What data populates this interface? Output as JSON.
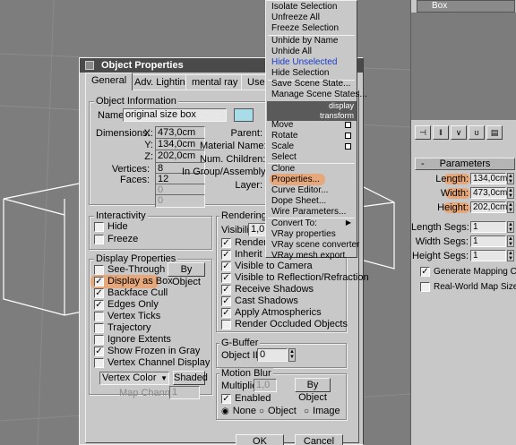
{
  "colors": {
    "accent_blue": "#1a3cc8",
    "highlight": "#ff8c3c",
    "swatch": "#a8dce8",
    "title_bg": "#4a4a4a"
  },
  "dialog": {
    "title": "Object Properties",
    "tabs": [
      "General",
      "Adv. Lighting",
      "mental ray",
      "User D"
    ],
    "object_info": {
      "group_title": "Object Information",
      "name_label": "Name:",
      "name_value": "original size box",
      "dimensions_label": "Dimensions:",
      "x_label": "X:",
      "x_value": "473,0cm",
      "y_label": "Y:",
      "y_value": "134,0cm",
      "z_label": "Z:",
      "z_value": "202,0cm",
      "vertices_label": "Vertices:",
      "vertices_value": "8",
      "faces_label": "Faces:",
      "faces_value": "12",
      "blank1": "0",
      "blank2": "0",
      "parent_label": "Parent:",
      "material_label": "Material Name:",
      "children_label": "Num. Children:",
      "group_label": "In Group/Assembly:",
      "layer_label": "Layer:"
    },
    "interactivity": {
      "title": "Interactivity",
      "hide": "Hide",
      "freeze": "Freeze"
    },
    "display_props": {
      "title": "Display Properties",
      "see_through": "See-Through",
      "by_object": "By Object",
      "display_as_box": "Display as Box",
      "backface_cull": "Backface Cull",
      "edges_only": "Edges Only",
      "vertex_ticks": "Vertex Ticks",
      "trajectory": "Trajectory",
      "ignore_extents": "Ignore Extents",
      "show_frozen_gray": "Show Frozen in Gray",
      "vertex_channel_display": "Vertex Channel Display",
      "vertex_color": "Vertex Color",
      "shaded": "Shaded",
      "map_channel_label": "Map Channel:",
      "map_channel_value": "1"
    },
    "rendering": {
      "title": "Rendering Co",
      "visibility_label": "Visibility:",
      "visibility_value": "1,0",
      "renderable": "Renderab",
      "inherit_visibility": "Inherit Visi",
      "visible_camera": "Visible to Camera",
      "visible_reflection": "Visible to Reflection/Refraction",
      "receive_shadows": "Receive Shadows",
      "cast_shadows": "Cast Shadows",
      "apply_atmospherics": "Apply Atmospherics",
      "render_occluded": "Render Occluded Objects"
    },
    "gbuffer": {
      "title": "G-Buffer",
      "object_id_label": "Object ID:",
      "object_id_value": "0"
    },
    "motion_blur": {
      "title": "Motion Blur",
      "multiplier_label": "Multiplier:",
      "multiplier_value": "1,0",
      "by_object": "By Object",
      "enabled": "Enabled",
      "none": "None",
      "object": "Object",
      "image": "Image"
    },
    "ok": "OK",
    "cancel": "Cancel"
  },
  "quad_menu": {
    "display_header": "display",
    "transform_header": "transform",
    "items_top": [
      "Isolate Selection",
      "Unfreeze All",
      "Freeze Selection"
    ],
    "items_mid": [
      "Unhide by Name",
      "Unhide All",
      "Hide Unselected",
      "Hide Selection"
    ],
    "items_state": [
      "Save Scene State...",
      "Manage Scene States..."
    ],
    "items_transform": [
      "Move",
      "Rotate",
      "Scale",
      "Select",
      "Clone",
      "Properties...",
      "Curve Editor...",
      "Dope Sheet...",
      "Wire Parameters...",
      "Convert To:",
      "VRay properties",
      "VRay scene converter",
      "VRay mesh export"
    ]
  },
  "panel": {
    "object_name": "Box",
    "params_title": "Parameters",
    "length_label": "Length:",
    "length_value": "134,0cm",
    "width_label": "Width:",
    "width_value": "473,0cm",
    "height_label": "Height:",
    "height_value": "202,0cm",
    "length_segs_label": "Length Segs:",
    "length_segs_value": "1",
    "width_segs_label": "Width Segs:",
    "width_segs_value": "1",
    "height_segs_label": "Height Segs:",
    "height_segs_value": "1",
    "gen_mapping": "Generate Mapping Coords",
    "real_world": "Real-World Map Size"
  }
}
